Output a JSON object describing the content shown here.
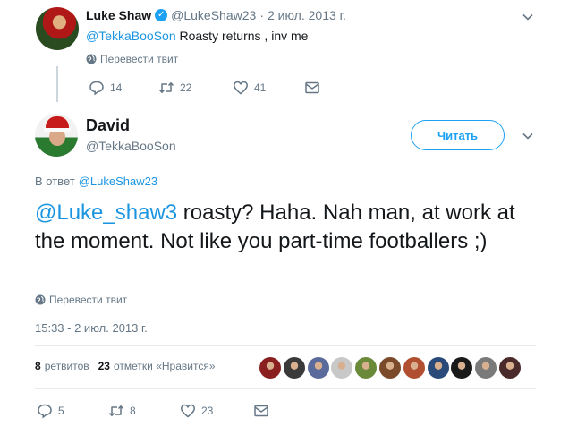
{
  "parent_tweet": {
    "name": "Luke Shaw",
    "handle": "@LukeShaw23",
    "separator": "·",
    "date": "2 июл. 2013 г.",
    "mention": "@TekkaBooSon",
    "text": " Roasty returns , inv me",
    "translate_label": "Перевести твит",
    "actions": {
      "replies": "14",
      "retweets": "22",
      "likes": "41"
    }
  },
  "main_tweet": {
    "name": "David",
    "handle": "@TekkaBooSon",
    "follow_label": "Читать",
    "reply_prefix": "В ответ",
    "reply_to": "@LukeShaw23",
    "mention": "@Luke_shaw3",
    "text": " roasty? Haha. Nah man, at work at the moment. Not like you part-time footballers ;)",
    "translate_label": "Перевести твит",
    "timestamp": "15:33 - 2 июл. 2013 г.",
    "retweet_count": "8",
    "retweet_label": "ретвитов",
    "like_count": "23",
    "like_label": "отметки «Нравится»",
    "actions": {
      "replies": "5",
      "retweets": "8",
      "likes": "23"
    }
  },
  "liker_avatar_colors": [
    "#8a1f1f",
    "#3a3a3a",
    "#5a6a9a",
    "#c8c8c8",
    "#6a8a3a",
    "#7a4a2a",
    "#b05030",
    "#2a4a7a",
    "#1a1a1a",
    "#7a7a7a",
    "#4a2a2a"
  ],
  "colors": {
    "accent": "#1da1f2",
    "link": "#1b95e0",
    "muted": "#657786",
    "text": "#14171a"
  }
}
